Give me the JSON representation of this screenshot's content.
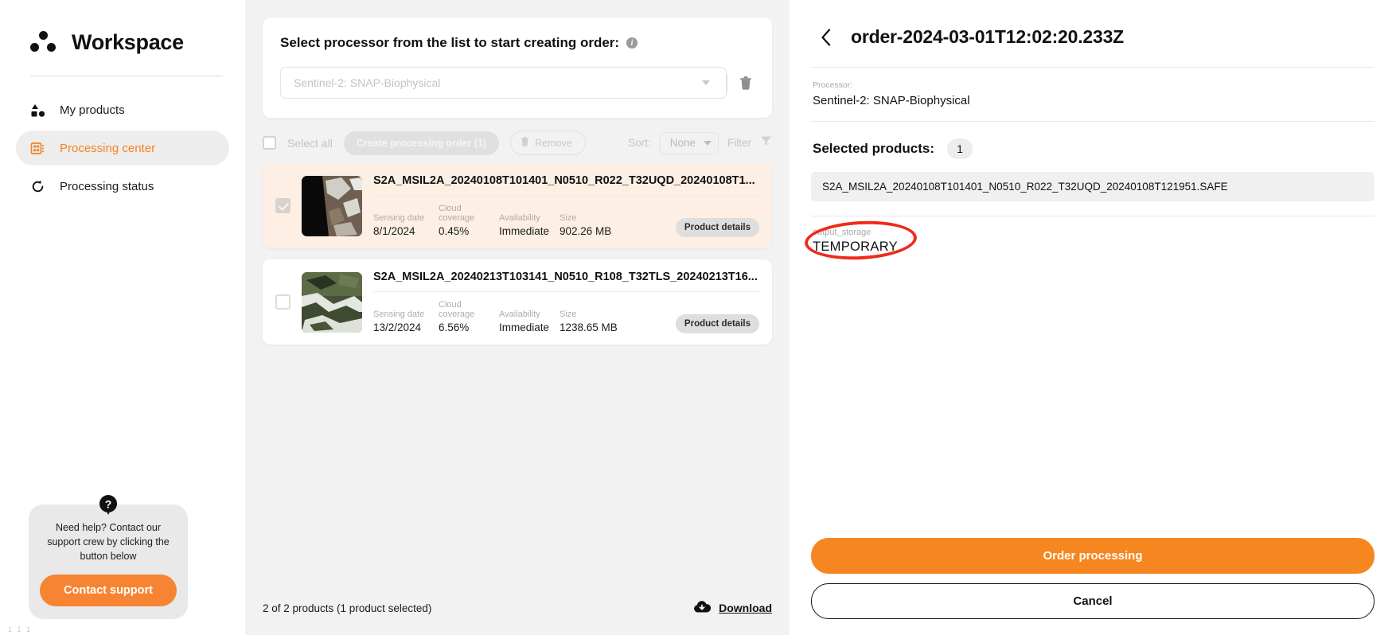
{
  "sidebar": {
    "brand": "Workspace",
    "items": [
      {
        "label": "My products",
        "icon": "products-icon",
        "active": false
      },
      {
        "label": "Processing center",
        "icon": "grid-icon",
        "active": true
      },
      {
        "label": "Processing status",
        "icon": "refresh-icon",
        "active": false
      }
    ],
    "support": {
      "icon": "question-mark-icon",
      "text": "Need help? Contact our support crew by clicking the button below",
      "button": "Contact support"
    },
    "corner_mark": "1 1 1"
  },
  "center": {
    "processor_card": {
      "title": "Select processor from the list to start creating order:",
      "info_icon": "info-icon",
      "select_placeholder": "Sentinel-2: SNAP-Biophysical",
      "select_value": "",
      "dropdown_icon": "chevron-down-icon",
      "delete_icon": "trash-icon"
    },
    "toolbar": {
      "select_all": "Select all",
      "create_order": "Create processing order (1)",
      "remove": "Remove",
      "remove_icon": "trash-icon",
      "sort_label": "Sort:",
      "sort_value": "None",
      "filter_label": "Filter",
      "filter_icon": "funnel-icon"
    },
    "meta_headers": {
      "sensing_date": "Sensing date",
      "cloud_coverage": "Cloud coverage",
      "availability": "Availability",
      "size": "Size"
    },
    "products": [
      {
        "name": "S2A_MSIL2A_20240108T101401_N0510_R022_T32UQD_20240108T1...",
        "sensing_date": "8/1/2024",
        "cloud_coverage": "0.45%",
        "availability": "Immediate",
        "size": "902.26 MB",
        "details_label": "Product details",
        "selected": true
      },
      {
        "name": "S2A_MSIL2A_20240213T103141_N0510_R108_T32TLS_20240213T16...",
        "sensing_date": "13/2/2024",
        "cloud_coverage": "6.56%",
        "availability": "Immediate",
        "size": "1238.65 MB",
        "details_label": "Product details",
        "selected": false
      }
    ],
    "footer": {
      "count_text": "2 of 2 products (1 product selected)",
      "download_label": "Download",
      "download_icon": "cloud-download-icon"
    }
  },
  "right_panel": {
    "back_icon": "chevron-left-icon",
    "title": "order-2024-03-01T12:02:20.233Z",
    "processor_key": "Processor:",
    "processor_value": "Sentinel-2: SNAP-Biophysical",
    "selected_products_label": "Selected products:",
    "selected_products_count": "1",
    "selected_product_item": "S2A_MSIL2A_20240108T101401_N0510_R022_T32UQD_20240108T121951.SAFE",
    "output_storage_key": "output_storage",
    "output_storage_value": "TEMPORARY",
    "order_button": "Order processing",
    "cancel_button": "Cancel"
  },
  "colors": {
    "accent_orange": "#f6861f",
    "annotation_red": "#ee2b1b",
    "panel_bg": "#f2f2f2",
    "selected_row": "#fdefe3"
  }
}
